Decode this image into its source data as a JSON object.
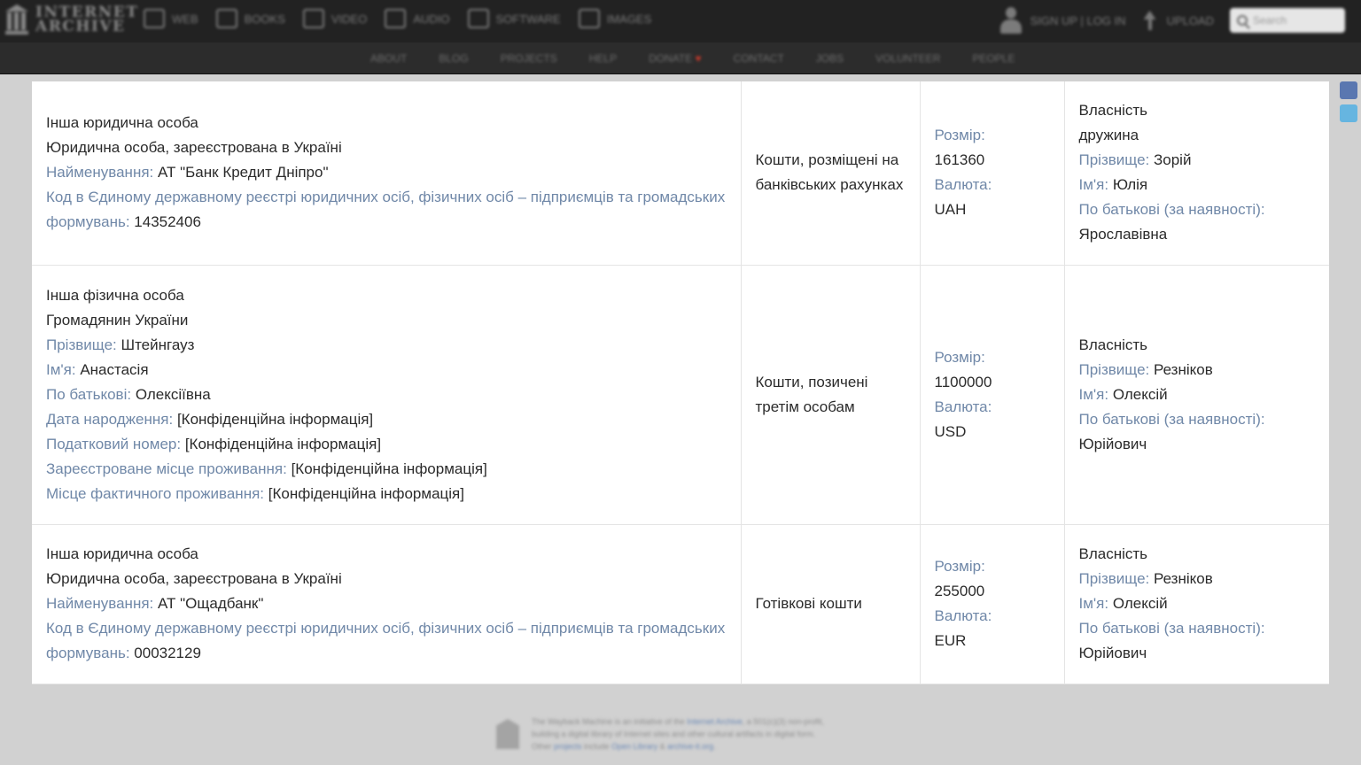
{
  "topbar": {
    "logo_line1": "INTERNET",
    "logo_line2": "ARCHIVE",
    "nav": [
      "WEB",
      "BOOKS",
      "VIDEO",
      "AUDIO",
      "SOFTWARE",
      "IMAGES"
    ],
    "nav_icons": [
      "web-icon",
      "books-icon",
      "video-icon",
      "audio-icon",
      "software-icon",
      "images-icon"
    ],
    "signin": "SIGN UP | LOG IN",
    "upload": "UPLOAD",
    "search_placeholder": "Search"
  },
  "subnav": [
    "ABOUT",
    "BLOG",
    "PROJECTS",
    "HELP",
    "DONATE",
    "CONTACT",
    "JOBS",
    "VOLUNTEER",
    "PEOPLE"
  ],
  "donate_heart": "♥",
  "rows": [
    {
      "col1": [
        {
          "text": "Інша юридична особа"
        },
        {
          "text": "Юридична особа, зареєстрована в Україні"
        },
        {
          "label": "Найменування:",
          "value": "АТ \"Банк Кредит Дніпро\""
        },
        {
          "label": "Код в Єдиному державному реєстрі юридичних осіб, фізичних осіб – підприємців та громадських формувань:",
          "value": "14352406"
        }
      ],
      "col2": "Кошти, розміщені на банківських рахунках",
      "size_label": "Розмір:",
      "size": "161360",
      "currency_label": "Валюта:",
      "currency": "UAH",
      "owner": [
        {
          "text": "Власність"
        },
        {
          "text": "дружина"
        },
        {
          "label": "Прізвище:",
          "value": "Зорій"
        },
        {
          "label": "Ім'я:",
          "value": "Юлія"
        },
        {
          "label": "По батькові (за наявності):",
          "value": "Ярославівна",
          "newline": true
        }
      ]
    },
    {
      "col1": [
        {
          "text": "Інша фізична особа"
        },
        {
          "text": "Громадянин України"
        },
        {
          "label": "Прізвище:",
          "value": "Штейнгауз"
        },
        {
          "label": "Ім'я:",
          "value": "Анастасія"
        },
        {
          "label": "По батькові:",
          "value": "Олексіївна"
        },
        {
          "label": "Дата народження:",
          "value": "[Конфіденційна інформація]"
        },
        {
          "label": "Податковий номер:",
          "value": "[Конфіденційна інформація]"
        },
        {
          "label": "Зареєстроване місце проживання:",
          "value": "[Конфіденційна інформація]"
        },
        {
          "label": "Місце фактичного проживання:",
          "value": "[Конфіденційна інформація]"
        }
      ],
      "col2": "Кошти, позичені третім особам",
      "size_label": "Розмір:",
      "size": "1100000",
      "currency_label": "Валюта:",
      "currency": "USD",
      "owner": [
        {
          "text": "Власність"
        },
        {
          "label": "Прізвище:",
          "value": "Резніков"
        },
        {
          "label": "Ім'я:",
          "value": "Олексій"
        },
        {
          "label": "По батькові (за наявності):",
          "value": "Юрійович",
          "newline": true
        }
      ]
    },
    {
      "col1": [
        {
          "text": "Інша юридична особа"
        },
        {
          "text": "Юридична особа, зареєстрована в Україні"
        },
        {
          "label": "Найменування:",
          "value": "АТ \"Ощадбанк\""
        },
        {
          "label": "Код в Єдиному державному реєстрі юридичних осіб, фізичних осіб – підприємців та громадських формувань:",
          "value": "00032129"
        }
      ],
      "col2": "Готівкові кошти",
      "size_label": "Розмір:",
      "size": "255000",
      "currency_label": "Валюта:",
      "currency": "EUR",
      "owner": [
        {
          "text": "Власність"
        },
        {
          "label": "Прізвище:",
          "value": "Резніков"
        },
        {
          "label": "Ім'я:",
          "value": "Олексій"
        },
        {
          "label": "По батькові (за наявності):",
          "value": "Юрійович",
          "newline": true
        }
      ]
    }
  ],
  "footer": {
    "line1_a": "The Wayback Machine is an initiative of the ",
    "line1_link": "Internet Archive",
    "line1_b": ", a 501(c)(3) non-profit,",
    "line2": "building a digital library of Internet sites and other cultural artifacts in digital form.",
    "line3_a": "Other ",
    "line3_link1": "projects",
    "line3_b": " include ",
    "line3_link2": "Open Library",
    "line3_c": " & ",
    "line3_link3": "archive-it.org",
    "line3_d": "."
  },
  "social_icons": [
    "facebook-icon",
    "twitter-icon"
  ]
}
